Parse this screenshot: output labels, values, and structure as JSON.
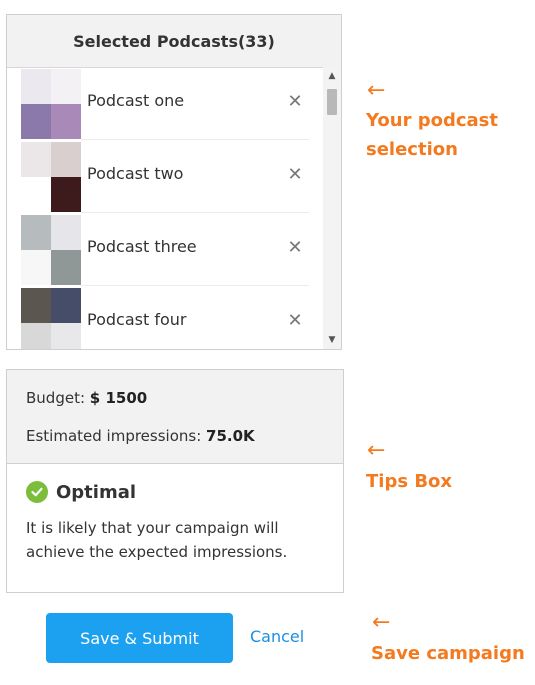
{
  "panel": {
    "title": "Selected Podcasts(33)",
    "remove_glyph": "✕",
    "podcasts": [
      {
        "name": "Podcast one",
        "thumb_colors": [
          "#ece8ef",
          "#f3f1f4",
          "#8c79ac",
          "#a889b8"
        ]
      },
      {
        "name": "Podcast two",
        "thumb_colors": [
          "#ebe6e8",
          "#d9cfcf",
          "#ffffff",
          "#3d1b1c"
        ]
      },
      {
        "name": "Podcast three",
        "thumb_colors": [
          "#b6bbbd",
          "#e6e6ea",
          "#f7f7f7",
          "#8f9797"
        ]
      },
      {
        "name": "Podcast four",
        "thumb_colors": [
          "#5b5650",
          "#454d68",
          "#d8d8d8",
          "#e8e8ea"
        ]
      }
    ]
  },
  "summary": {
    "budget_label": "Budget:",
    "budget_value": "$ 1500",
    "impressions_label": "Estimated impressions:",
    "impressions_value": "75.0K",
    "status": "Optimal",
    "status_color": "#7cbd3b",
    "tip": "It is likely that your campaign will achieve the expected impressions."
  },
  "actions": {
    "save_label": "Save & Submit",
    "cancel_label": "Cancel",
    "accent": "#1ba1f0"
  },
  "annotations": {
    "arrow": "←",
    "selection_label": "Your podcast selection",
    "tips_label": "Tips Box",
    "save_label": "Save campaign",
    "color": "#f37a1f"
  }
}
